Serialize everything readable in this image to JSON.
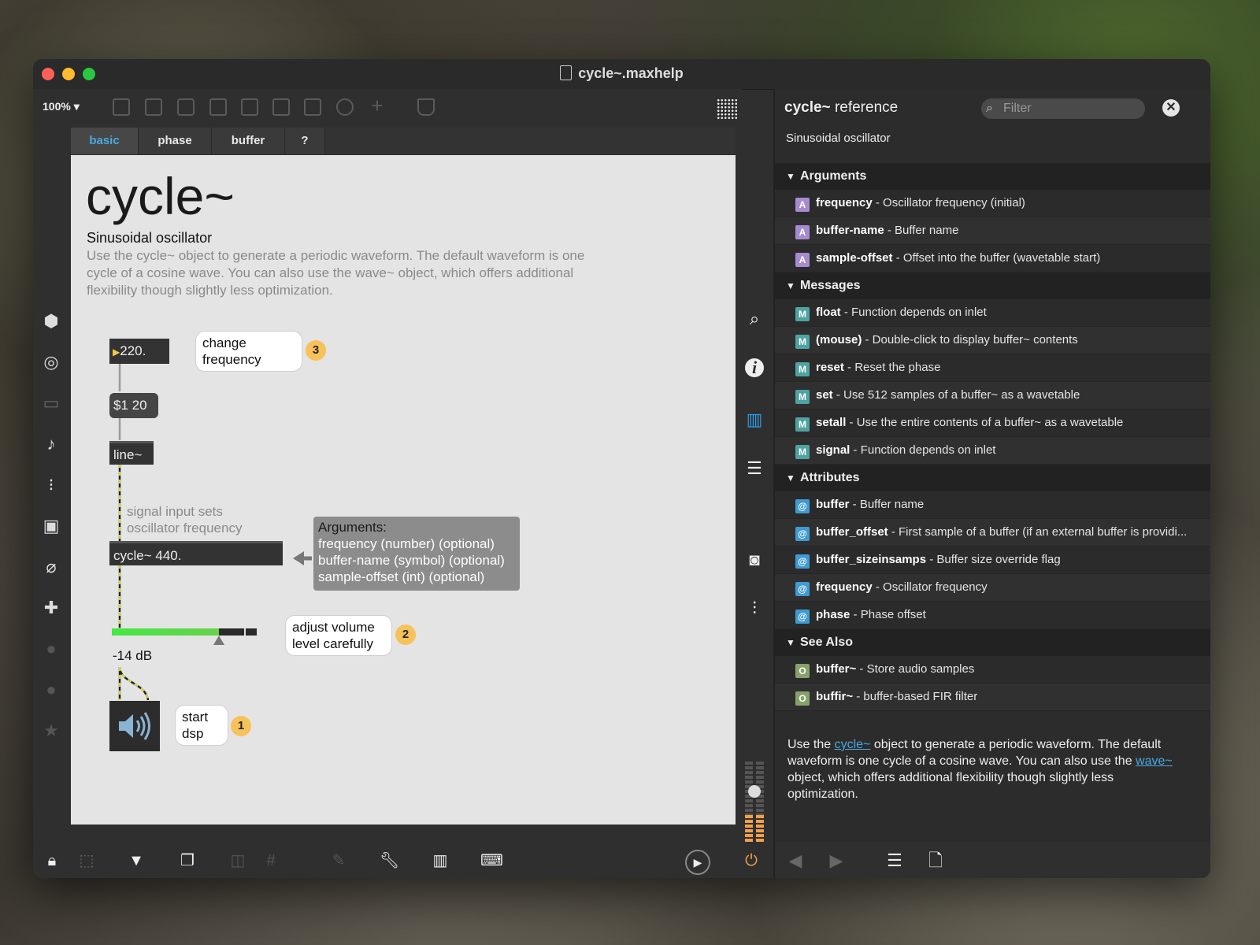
{
  "window": {
    "title": "cycle~.maxhelp"
  },
  "toolbar": {
    "zoom": "100%"
  },
  "tabs": [
    {
      "label": "basic"
    },
    {
      "label": "phase"
    },
    {
      "label": "buffer"
    },
    {
      "label": "?"
    }
  ],
  "patch": {
    "title": "cycle~",
    "subtitle": "Sinusoidal oscillator",
    "description": "Use the cycle~ object to generate a periodic waveform. The default waveform is one cycle of a cosine wave. You can also use the wave~ object, which offers additional flexibility though slightly less optimization.",
    "number_box": "220.",
    "message_box": "$1 20",
    "line_obj": "line~",
    "cycle_obj": "cycle~ 440.",
    "comment_signal_1": "signal input sets",
    "comment_signal_2": "oscillator frequency",
    "bubble_freq_1": "change",
    "bubble_freq_2": "frequency",
    "badge_3": "3",
    "args_title": "Arguments:",
    "args_1": "frequency (number) (optional)",
    "args_2": "buffer-name (symbol) (optional)",
    "args_3": "sample-offset (int) (optional)",
    "gain_level": 0.74,
    "gain_readout": "-14 dB",
    "bubble_vol_1": "adjust volume",
    "bubble_vol_2": "level carefully",
    "badge_2": "2",
    "bubble_dsp_1": "start",
    "bubble_dsp_2": "dsp",
    "badge_1": "1"
  },
  "reference": {
    "title_obj": "cycle~",
    "title_word": "reference",
    "filter_placeholder": "Filter",
    "subtitle": "Sinusoidal oscillator",
    "sections": {
      "arguments": "Arguments",
      "messages": "Messages",
      "attributes": "Attributes",
      "see_also": "See Also"
    },
    "arguments": [
      {
        "badge": "A",
        "name": "frequency",
        "desc": " - Oscillator frequency (initial)"
      },
      {
        "badge": "A",
        "name": "buffer-name",
        "desc": " - Buffer name"
      },
      {
        "badge": "A",
        "name": "sample-offset",
        "desc": " - Offset into the buffer (wavetable start)"
      }
    ],
    "messages": [
      {
        "badge": "M",
        "name": "float",
        "desc": " - Function depends on inlet"
      },
      {
        "badge": "M",
        "name": "(mouse)",
        "desc": " - Double-click to display buffer~ contents"
      },
      {
        "badge": "M",
        "name": "reset",
        "desc": " - Reset the phase"
      },
      {
        "badge": "M",
        "name": "set",
        "desc": " - Use 512 samples of a buffer~ as a wavetable"
      },
      {
        "badge": "M",
        "name": "setall",
        "desc": " - Use the entire contents of a buffer~ as a wavetable"
      },
      {
        "badge": "M",
        "name": "signal",
        "desc": " - Function depends on inlet"
      }
    ],
    "attributes": [
      {
        "badge": "@",
        "name": "buffer",
        "desc": " - Buffer name"
      },
      {
        "badge": "@",
        "name": "buffer_offset",
        "desc": " - First sample of a buffer (if an external buffer is providi..."
      },
      {
        "badge": "@",
        "name": "buffer_sizeinsamps",
        "desc": " - Buffer size override flag"
      },
      {
        "badge": "@",
        "name": "frequency",
        "desc": " - Oscillator frequency"
      },
      {
        "badge": "@",
        "name": "phase",
        "desc": " - Phase offset"
      }
    ],
    "see_also": [
      {
        "badge": "O",
        "name": "buffer~",
        "desc": " - Store audio samples"
      },
      {
        "badge": "O",
        "name": "buffir~",
        "desc": " - buffer-based FIR filter"
      }
    ],
    "desc_1": "Use the ",
    "desc_link_1": "cycle~",
    "desc_2": " object to generate a periodic waveform. The default waveform is one cycle of a cosine wave. You can also use the ",
    "desc_link_2": "wave~",
    "desc_3": " object, which offers additional flexibility though slightly less optimization."
  }
}
